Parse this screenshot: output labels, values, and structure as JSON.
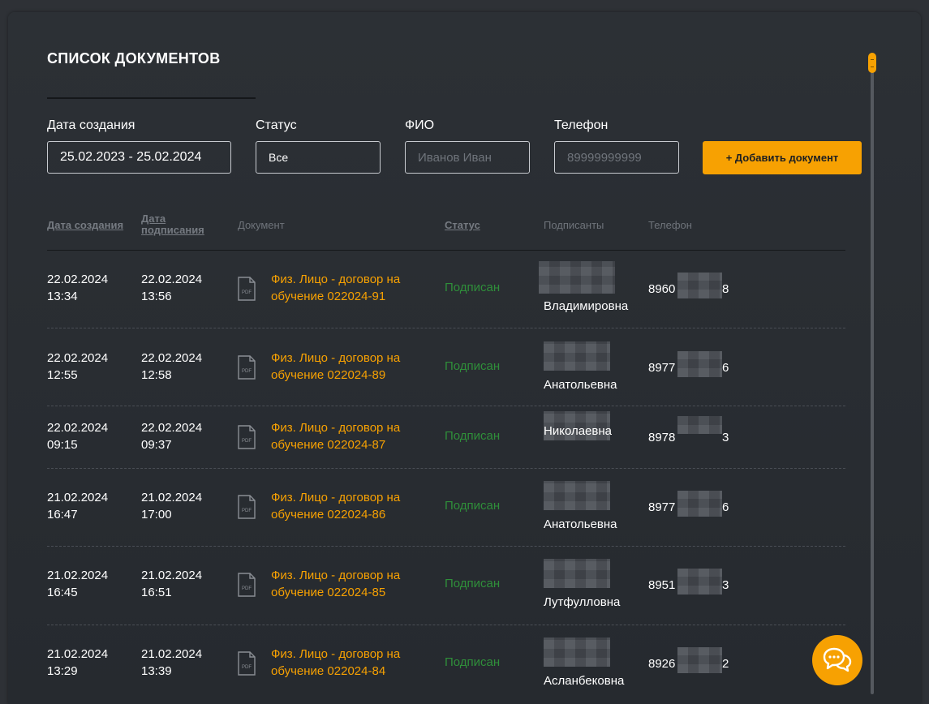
{
  "page": {
    "title": "СПИСОК ДОКУМЕНТОВ"
  },
  "filters": {
    "date_label": "Дата создания",
    "date_value": "25.02.2023 - 25.02.2024",
    "status_label": "Статус",
    "status_value": "Все",
    "fio_label": "ФИО",
    "fio_placeholder": "Иванов Иван",
    "phone_label": "Телефон",
    "phone_placeholder": "89999999999",
    "add_button": "+ Добавить документ"
  },
  "table": {
    "headers": {
      "created": "Дата создания",
      "signed_1": "Дата",
      "signed_2": "подписания",
      "document": "Документ",
      "status": "Статус",
      "signers": "Подписанты",
      "phone": "Телефон"
    },
    "rows": [
      {
        "created_date": "22.02.2024",
        "created_time": "13:34",
        "signed_date": "22.02.2024",
        "signed_time": "13:56",
        "doc_1": "Физ. Лицо - договор на",
        "doc_2": "обучение 022024-91",
        "status": "Подписан",
        "signer": "Владимировна",
        "phone_start": "8960",
        "phone_end": "8"
      },
      {
        "created_date": "22.02.2024",
        "created_time": "12:55",
        "signed_date": "22.02.2024",
        "signed_time": "12:58",
        "doc_1": "Физ. Лицо - договор на",
        "doc_2": "обучение 022024-89",
        "status": "Подписан",
        "signer": "Анатольевна",
        "phone_start": "8977",
        "phone_end": "6"
      },
      {
        "created_date": "22.02.2024",
        "created_time": "09:15",
        "signed_date": "22.02.2024",
        "signed_time": "09:37",
        "doc_1": "Физ. Лицо - договор на",
        "doc_2": "обучение 022024-87",
        "status": "Подписан",
        "signer": "Николаевна",
        "phone_start": "8978",
        "phone_end": "3"
      },
      {
        "created_date": "21.02.2024",
        "created_time": "16:47",
        "signed_date": "21.02.2024",
        "signed_time": "17:00",
        "doc_1": "Физ. Лицо - договор на",
        "doc_2": "обучение 022024-86",
        "status": "Подписан",
        "signer": "Анатольевна",
        "phone_start": "8977",
        "phone_end": "6"
      },
      {
        "created_date": "21.02.2024",
        "created_time": "16:45",
        "signed_date": "21.02.2024",
        "signed_time": "16:51",
        "doc_1": "Физ. Лицо - договор на",
        "doc_2": "обучение 022024-85",
        "status": "Подписан",
        "signer": "Лутфулловна",
        "phone_start": "8951",
        "phone_end": "3"
      },
      {
        "created_date": "21.02.2024",
        "created_time": "13:29",
        "signed_date": "21.02.2024",
        "signed_time": "13:39",
        "doc_1": "Физ. Лицо - договор на",
        "doc_2": "обучение 022024-84",
        "status": "Подписан",
        "signer": "Асланбековна",
        "phone_start": "8926",
        "phone_end": "2"
      }
    ]
  },
  "icons": {
    "document": "pdf-file-icon",
    "chat": "chat-bubbles-icon"
  },
  "colors": {
    "accent": "#f7a102",
    "status_signed": "#2f8f3a",
    "background": "#2b2e33"
  }
}
